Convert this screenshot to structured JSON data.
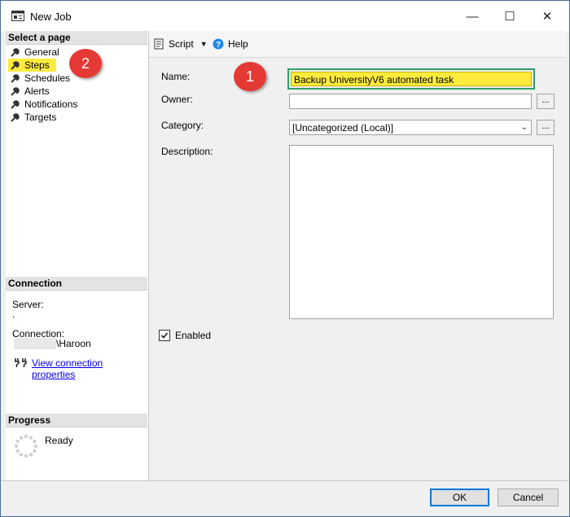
{
  "window": {
    "title": "New Job",
    "minimize_symbol": "—",
    "maximize_symbol": "☐",
    "close_symbol": "✕"
  },
  "left_panel": {
    "select_page_header": "Select a page",
    "pages": [
      {
        "label": "General",
        "icon": "wrench-icon",
        "active": false
      },
      {
        "label": "Steps",
        "icon": "wrench-icon",
        "active": true
      },
      {
        "label": "Schedules",
        "icon": "wrench-icon",
        "active": false
      },
      {
        "label": "Alerts",
        "icon": "wrench-icon",
        "active": false
      },
      {
        "label": "Notifications",
        "icon": "wrench-icon",
        "active": false
      },
      {
        "label": "Targets",
        "icon": "wrench-icon",
        "active": false
      }
    ],
    "connection_header": "Connection",
    "server_label": "Server:",
    "server_value": ".",
    "connection_label": "Connection:",
    "connection_value": "\\Haroon",
    "view_connection_link": "View connection properties",
    "progress_header": "Progress",
    "progress_status": "Ready"
  },
  "toolbar": {
    "script_label": "Script",
    "help_label": "Help"
  },
  "form": {
    "name_label": "Name:",
    "name_value": "Backup UniversityV6 automated task",
    "owner_label": "Owner:",
    "owner_value": "",
    "category_label": "Category:",
    "category_value": "[Uncategorized (Local)]",
    "description_label": "Description:",
    "description_value": "",
    "browse_label": "...",
    "enabled_label": "Enabled",
    "enabled_checked": true
  },
  "annotations": {
    "badge_1": "1",
    "badge_2": "2"
  },
  "buttons": {
    "ok_label": "OK",
    "cancel_label": "Cancel"
  },
  "colors": {
    "highlight_yellow": "#ffeb3b",
    "highlight_border": "#2e9e6b",
    "badge_red": "#e53935",
    "link_blue": "#0000ee"
  }
}
